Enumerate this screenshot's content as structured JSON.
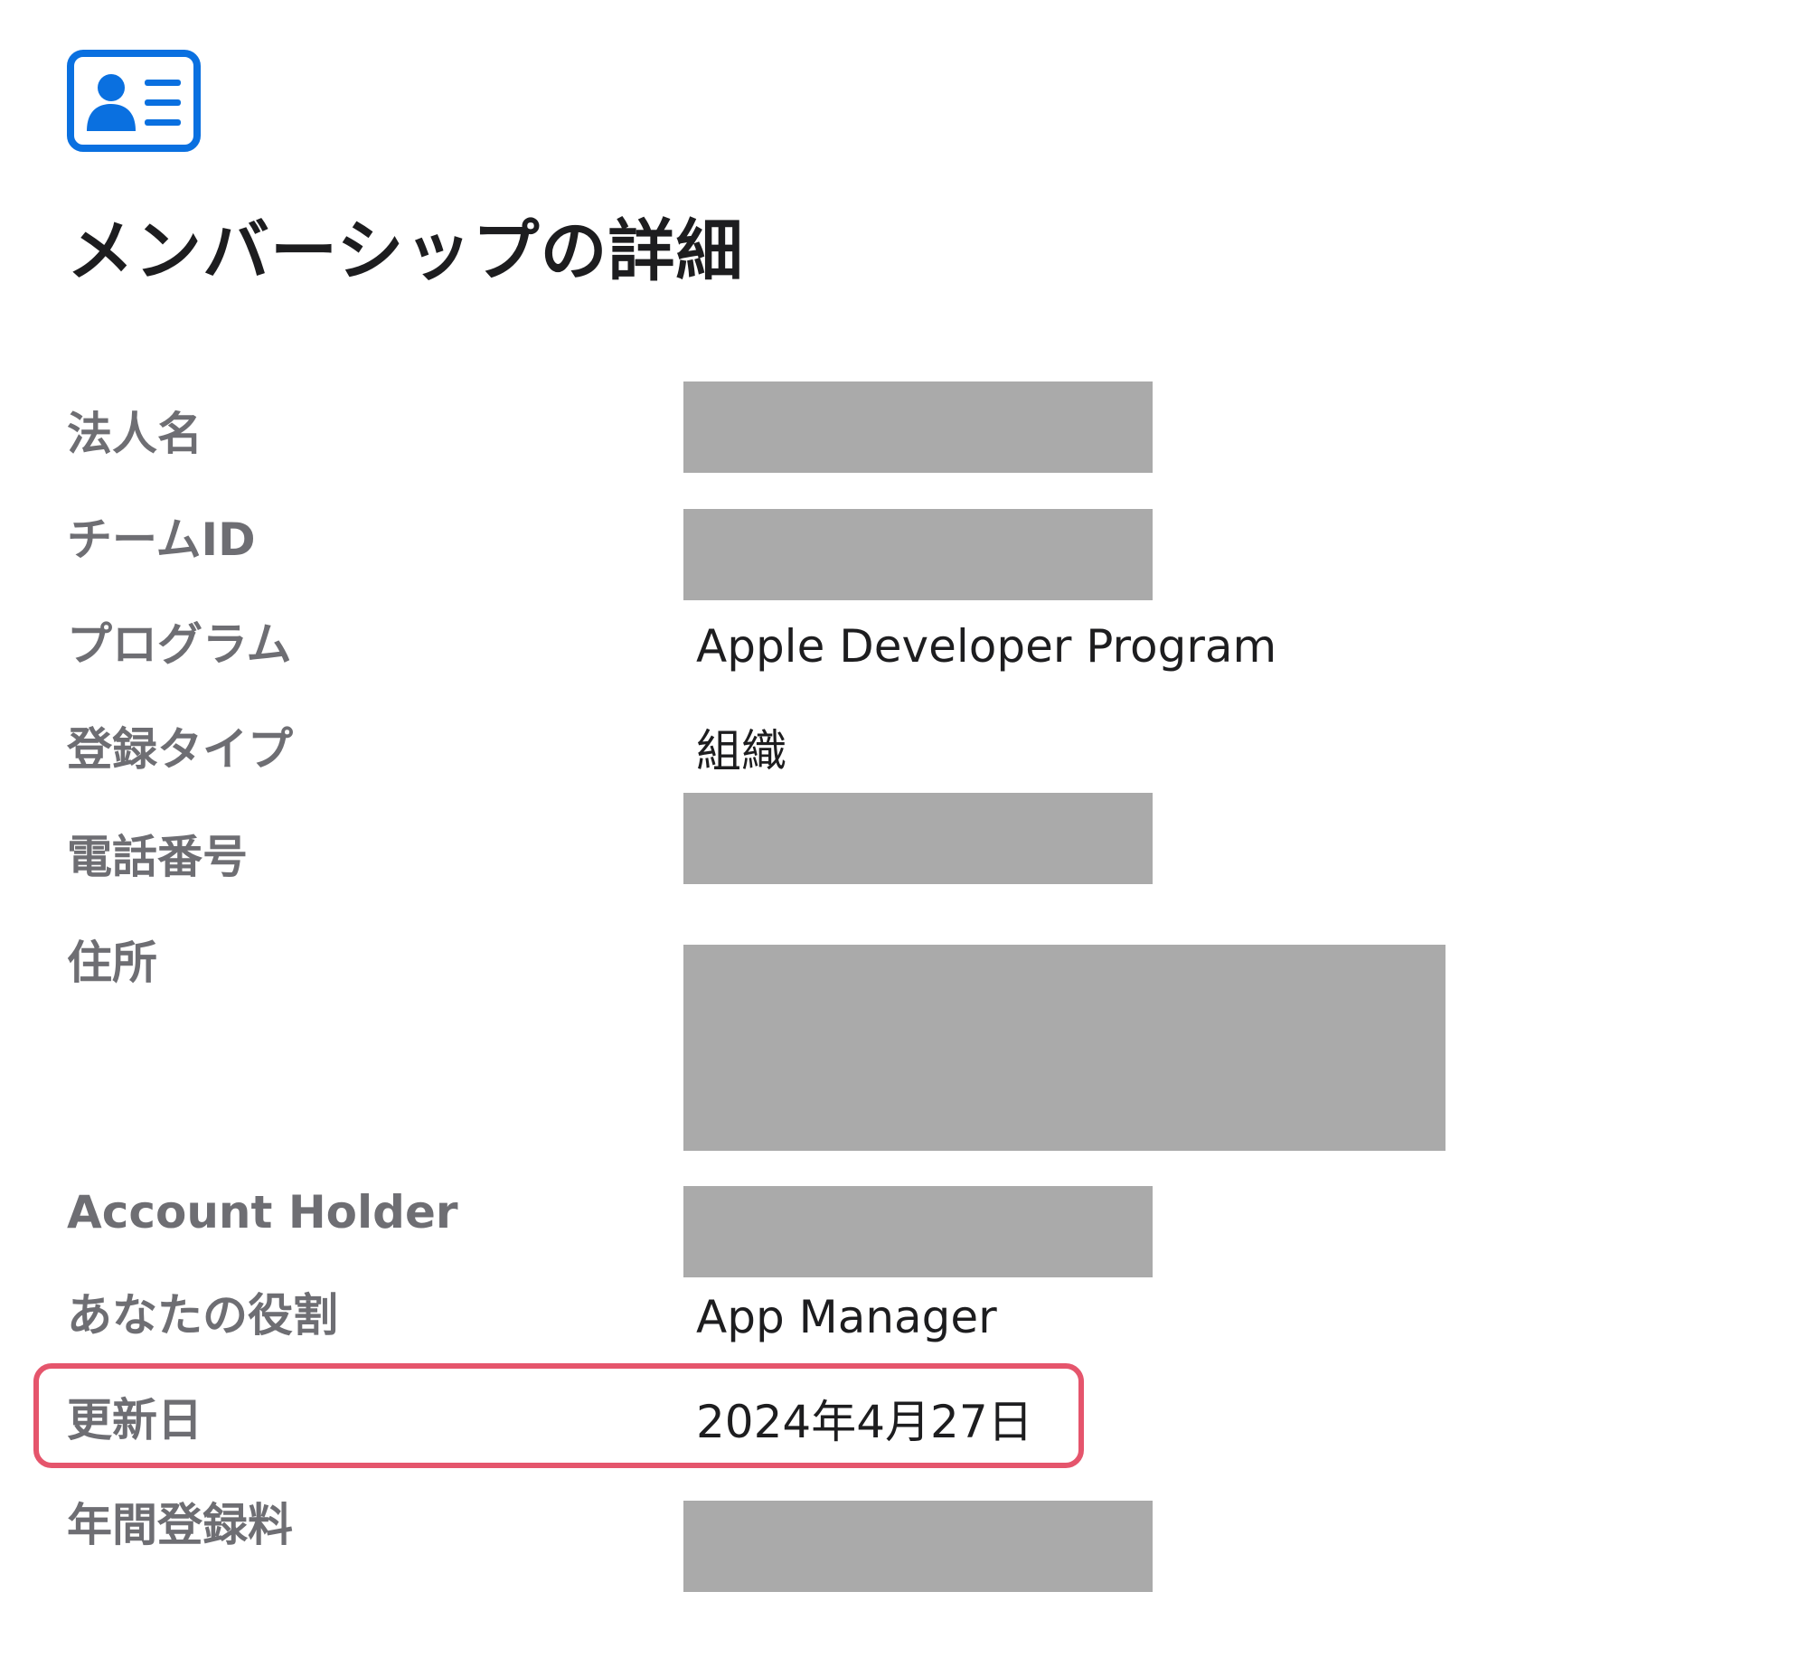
{
  "page": {
    "title": "メンバーシップの詳細",
    "icon": "membership-card-icon",
    "accent_color": "#0a70e0"
  },
  "details": [
    {
      "key": "corporate_name",
      "label": "法人名",
      "value": null,
      "redacted": true
    },
    {
      "key": "team_id",
      "label": "チームID",
      "value": null,
      "redacted": true
    },
    {
      "key": "program",
      "label": "プログラム",
      "value": "Apple Developer Program",
      "redacted": false
    },
    {
      "key": "enrollment_type",
      "label": "登録タイプ",
      "value": "組織",
      "redacted": false
    },
    {
      "key": "phone",
      "label": "電話番号",
      "value": null,
      "redacted": true
    },
    {
      "key": "address",
      "label": "住所",
      "value": null,
      "redacted": true
    },
    {
      "key": "account_holder",
      "label": "Account Holder",
      "value": null,
      "redacted": true
    },
    {
      "key": "your_role",
      "label": "あなたの役割",
      "value": "App Manager",
      "redacted": false
    },
    {
      "key": "renewal_date",
      "label": "更新日",
      "value": "2024年4月27日",
      "redacted": false,
      "highlighted": true,
      "highlight_color": "#e5556c"
    },
    {
      "key": "annual_fee",
      "label": "年間登録料",
      "value": null,
      "redacted": true
    }
  ],
  "redaction_color": "#aaaaaa"
}
